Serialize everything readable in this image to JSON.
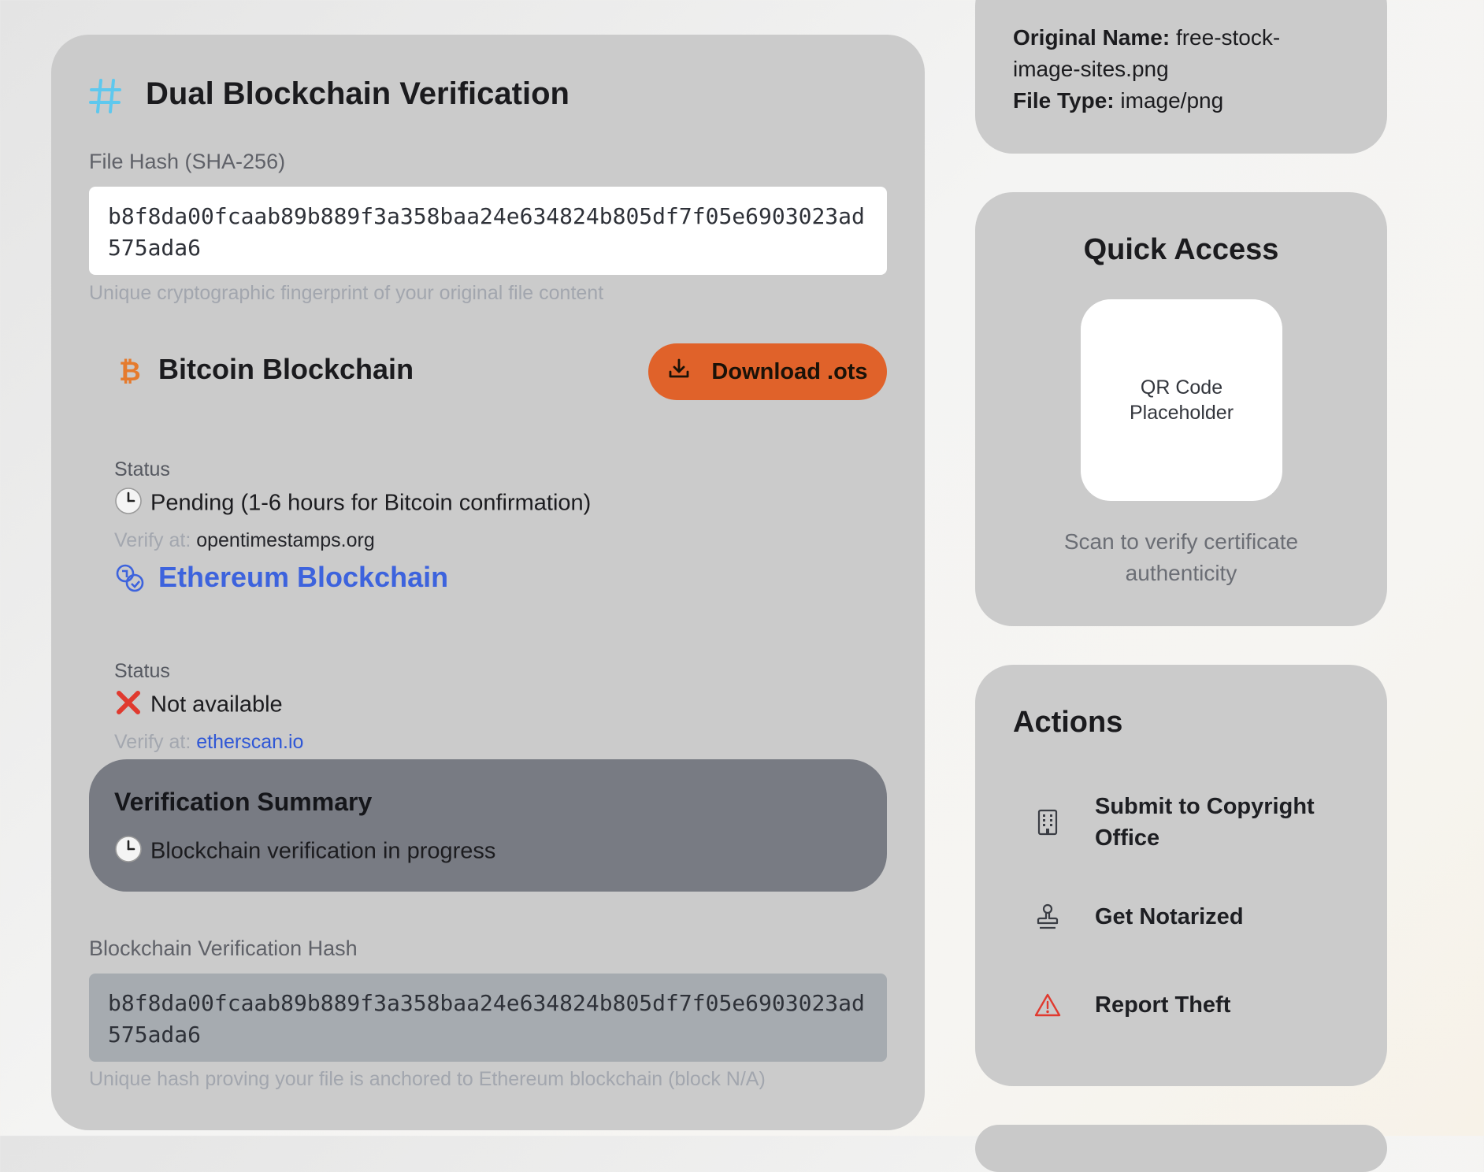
{
  "verification": {
    "title": "Dual Blockchain Verification",
    "file_hash_label": "File Hash (SHA-256)",
    "file_hash": "b8f8da00fcaab89b889f3a358baa24e634824b805df7f05e6903023ad575ada6",
    "file_hash_hint": "Unique cryptographic fingerprint of your original file content",
    "bitcoin": {
      "title": "Bitcoin Blockchain",
      "download_label": "Download .ots",
      "status_label": "Status",
      "status_value": "Pending (1-6 hours for Bitcoin confirmation)",
      "verify_prefix": "Verify at:",
      "verify_link": "opentimestamps.org"
    },
    "ethereum": {
      "title": "Ethereum Blockchain",
      "status_label": "Status",
      "status_value": "Not available",
      "verify_prefix": "Verify at:",
      "verify_link": "etherscan.io"
    },
    "summary": {
      "title": "Verification Summary",
      "value": "Blockchain verification in progress"
    },
    "blockchain_hash_label": "Blockchain Verification Hash",
    "blockchain_hash": "b8f8da00fcaab89b889f3a358baa24e634824b805df7f05e6903023ad575ada6",
    "blockchain_hash_hint": "Unique hash proving your file is anchored to Ethereum blockchain (block N/A)"
  },
  "file_info": {
    "original_name_label": "Original Name:",
    "original_name": "free-stock-image-sites.png",
    "file_type_label": "File Type:",
    "file_type": "image/png"
  },
  "quick_access": {
    "title": "Quick Access",
    "qr_placeholder": "QR Code Placeholder",
    "caption": "Scan to verify certificate authenticity"
  },
  "actions": {
    "title": "Actions",
    "items": [
      {
        "label": "Submit to Copyright Office",
        "icon": "building-icon"
      },
      {
        "label": "Get Notarized",
        "icon": "stamp-icon"
      },
      {
        "label": "Report Theft",
        "icon": "warning-icon"
      }
    ]
  },
  "colors": {
    "accent_orange": "#e0622a",
    "ethereum_blue": "#3d63dd",
    "hash_icon_cyan": "#5ec8ee",
    "warning_red": "#e03a2f"
  }
}
